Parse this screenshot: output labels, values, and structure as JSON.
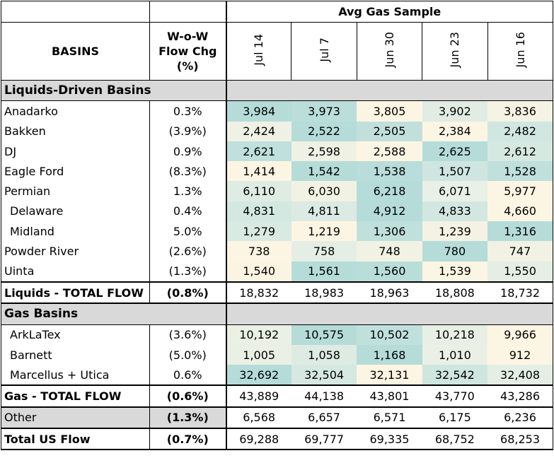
{
  "chart_data": {
    "type": "table",
    "group_header": "Avg Gas Sample",
    "col_basins": "BASINS",
    "col_wow": [
      "W-o-W",
      "Flow Chg",
      "(%)"
    ],
    "dates": [
      "Jul 14",
      "Jul 7",
      "Jun 30",
      "Jun 23",
      "Jun 16"
    ],
    "color_scale": {
      "low": "#fdf5e3",
      "mid": "#e4eee5",
      "high": "#b5dcd9"
    },
    "rows": [
      {
        "kind": "section",
        "label": "Liquids-Driven Basins"
      },
      {
        "kind": "data",
        "name": "Anadarko",
        "indent": false,
        "wow": "0.3%",
        "values": [
          "3,984",
          "3,973",
          "3,805",
          "3,902",
          "3,836"
        ]
      },
      {
        "kind": "data",
        "name": "Bakken",
        "indent": false,
        "wow": "(3.9%)",
        "values": [
          "2,424",
          "2,522",
          "2,505",
          "2,384",
          "2,482"
        ]
      },
      {
        "kind": "data",
        "name": "DJ",
        "indent": false,
        "wow": "0.9%",
        "values": [
          "2,621",
          "2,598",
          "2,588",
          "2,625",
          "2,612"
        ]
      },
      {
        "kind": "data",
        "name": "Eagle Ford",
        "indent": false,
        "wow": "(8.3%)",
        "values": [
          "1,414",
          "1,542",
          "1,538",
          "1,507",
          "1,528"
        ]
      },
      {
        "kind": "data",
        "name": "Permian",
        "indent": false,
        "wow": "1.3%",
        "values": [
          "6,110",
          "6,030",
          "6,218",
          "6,071",
          "5,977"
        ]
      },
      {
        "kind": "data",
        "name": "Delaware",
        "indent": true,
        "wow": "0.4%",
        "values": [
          "4,831",
          "4,811",
          "4,912",
          "4,833",
          "4,660"
        ]
      },
      {
        "kind": "data",
        "name": "Midland",
        "indent": true,
        "wow": "5.0%",
        "values": [
          "1,279",
          "1,219",
          "1,306",
          "1,239",
          "1,316"
        ]
      },
      {
        "kind": "data",
        "name": "Powder River",
        "indent": false,
        "wow": "(2.6%)",
        "values": [
          "738",
          "758",
          "748",
          "780",
          "747"
        ]
      },
      {
        "kind": "data",
        "name": "Uinta",
        "indent": false,
        "wow": "(1.3%)",
        "values": [
          "1,540",
          "1,561",
          "1,560",
          "1,539",
          "1,550"
        ]
      },
      {
        "kind": "total",
        "name": "Liquids - TOTAL FLOW",
        "wow": "(0.8%)",
        "values": [
          "18,832",
          "18,983",
          "18,963",
          "18,808",
          "18,732"
        ]
      },
      {
        "kind": "section",
        "label": "Gas Basins"
      },
      {
        "kind": "data",
        "name": "ArkLaTex",
        "indent": true,
        "wow": "(3.6%)",
        "values": [
          "10,192",
          "10,575",
          "10,502",
          "10,218",
          "9,966"
        ]
      },
      {
        "kind": "data",
        "name": "Barnett",
        "indent": true,
        "wow": "(5.0%)",
        "values": [
          "1,005",
          "1,058",
          "1,168",
          "1,010",
          "912"
        ]
      },
      {
        "kind": "data",
        "name": "Marcellus + Utica",
        "indent": true,
        "wow": "0.6%",
        "values": [
          "32,692",
          "32,504",
          "32,131",
          "32,542",
          "32,408"
        ]
      },
      {
        "kind": "total",
        "name": "Gas - TOTAL FLOW",
        "wow": "(0.6%)",
        "values": [
          "43,889",
          "44,138",
          "43,801",
          "43,770",
          "43,286"
        ]
      },
      {
        "kind": "other",
        "name": "Other",
        "wow": "(1.3%)",
        "values": [
          "6,568",
          "6,657",
          "6,571",
          "6,175",
          "6,236"
        ]
      },
      {
        "kind": "total",
        "name": "Total US Flow",
        "wow": "(0.7%)",
        "values": [
          "69,288",
          "69,777",
          "69,335",
          "68,752",
          "68,253"
        ]
      }
    ]
  }
}
